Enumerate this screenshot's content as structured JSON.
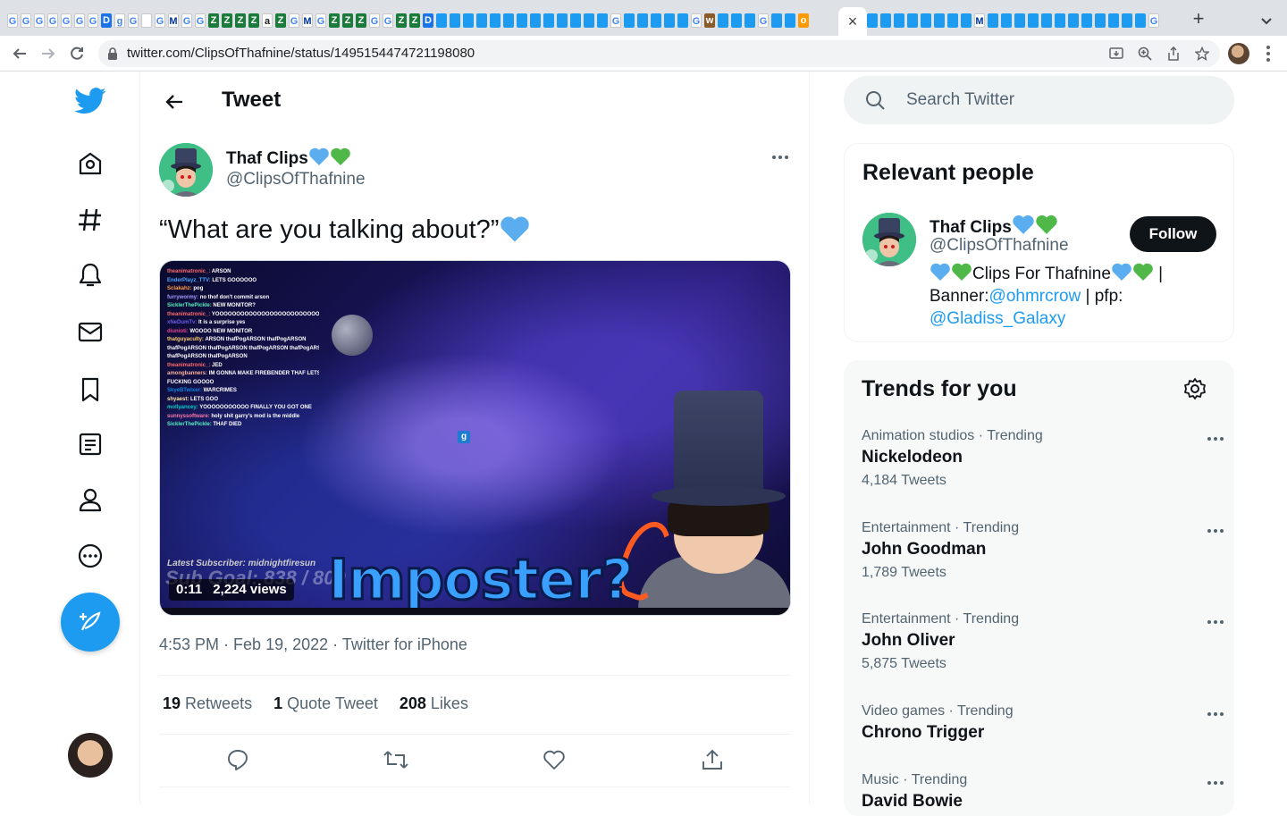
{
  "browser": {
    "url": "twitter.com/ClipsOfThafnine/status/1495154474721198080",
    "tab_close": "×",
    "new_tab": "+",
    "tab_icons_left": [
      "G",
      "G",
      "G",
      "G",
      "G",
      "G",
      "G",
      "D",
      "g",
      "G",
      "",
      "G",
      "M",
      "G",
      "G",
      "Z",
      "Z",
      "Z",
      "Z",
      "a",
      "Z",
      "G",
      "M",
      "G",
      "Z",
      "Z",
      "Z",
      "G",
      "G",
      "Z",
      "Z",
      "D",
      "t",
      "t",
      "t",
      "t",
      "t",
      "t",
      "t",
      "t",
      "t",
      "t",
      "t",
      "t",
      "t",
      "G",
      "t",
      "t",
      "t",
      "t",
      "t",
      "G",
      "w",
      "t",
      "t",
      "t",
      "G",
      "t",
      "t",
      "o"
    ],
    "tab_icons_right": [
      "t",
      "t",
      "t",
      "t",
      "t",
      "t",
      "t",
      "t",
      "M",
      "t",
      "t",
      "t",
      "t",
      "t",
      "t",
      "t",
      "t",
      "t",
      "t",
      "t",
      "t",
      "G"
    ]
  },
  "nav": {
    "items": [
      "home",
      "explore",
      "notifications",
      "messages",
      "bookmarks",
      "lists",
      "profile",
      "more"
    ]
  },
  "header": {
    "title": "Tweet"
  },
  "tweet": {
    "author_name": "Thaf Clips",
    "author_handle": "@ClipsOfThafnine",
    "text": "“What are you talking about?”",
    "media": {
      "overlay_text": "Imposter?",
      "latest_subscriber": "Latest Subscriber: midnightfiresun",
      "sub_goal": "Sub Goal: 838 / 800",
      "duration": "0:11",
      "views": "2,224 views",
      "chat": [
        {
          "user": "theanimatronic_",
          "msg": "ARSON",
          "color": "#ff6b6b"
        },
        {
          "user": "EnderPlayz_TTV",
          "msg": "LETS GOOOOOO",
          "color": "#4aa8ff"
        },
        {
          "user": "Sclakahz",
          "msg": "pog",
          "color": "#ff9f43"
        },
        {
          "user": "furrywormy",
          "msg": "no thof don't commit arson",
          "color": "#a29bfe"
        },
        {
          "user": "SicklerThePickle",
          "msg": "NEW MONITOR?",
          "color": "#55efc4"
        },
        {
          "user": "theanimatronic_",
          "msg": "YOOOOOOOOOOOOOOOOOOOOOOOOOOO",
          "color": "#ff6b6b"
        },
        {
          "user": "xNeDumTv",
          "msg": "It is a surprise yes",
          "color": "#6c5ce7"
        },
        {
          "user": "diunioti",
          "msg": "WOOOO NEW MONITOR",
          "color": "#e84393"
        },
        {
          "user": "thatguyaculty",
          "msg": "ARSON thafPogARSON thafPogARSON",
          "color": "#fdcb6e"
        },
        {
          "user": "",
          "msg": "thafPogARSON thafPogARSON thafPogARSON thafPogARSON",
          "color": "#fff"
        },
        {
          "user": "",
          "msg": "thafPogARSON thafPogARSON",
          "color": "#fff"
        },
        {
          "user": "theanimatronic_",
          "msg": "JED",
          "color": "#ff6b6b"
        },
        {
          "user": "amongbanners",
          "msg": "IM GONNA MAKE FIREBENDER THAF LETS",
          "color": "#fab1a0"
        },
        {
          "user": "",
          "msg": "FUCKING GOOOO",
          "color": "#fff"
        },
        {
          "user": "SkyeBTwixer",
          "msg": "WARCRIMES",
          "color": "#0984e3"
        },
        {
          "user": "shyaest",
          "msg": "LETS GOO",
          "color": "#ffeaa7"
        },
        {
          "user": "mollyancey",
          "msg": "YOOOOOOOOOOO FINALLY YOU GOT ONE",
          "color": "#00cec9"
        },
        {
          "user": "sunnyssoftware",
          "msg": "holy shit garry's mod is the middle",
          "color": "#fd79a8"
        },
        {
          "user": "SicklerThePickle",
          "msg": "THAF DIED",
          "color": "#55efc4"
        }
      ]
    },
    "time": "4:53 PM",
    "date": "Feb 19, 2022",
    "source": "Twitter for iPhone",
    "retweets": "19",
    "retweets_label": "Retweets",
    "quotes": "1",
    "quotes_label": "Quote Tweet",
    "likes": "208",
    "likes_label": "Likes"
  },
  "search": {
    "placeholder": "Search Twitter"
  },
  "relevant_people": {
    "title": "Relevant people",
    "name": "Thaf Clips",
    "handle": "@ClipsOfThafnine",
    "follow_label": "Follow",
    "bio_text1": "Clips For Thafnine",
    "bio_sep": " |",
    "bio_banner_label": "Banner:",
    "bio_banner_link": "@ohmrcrow",
    "bio_pfp_label": " | pfp:",
    "bio_pfp_link": "@Gladiss_Galaxy"
  },
  "trends": {
    "title": "Trends for you",
    "items": [
      {
        "category": "Animation studios · Trending",
        "name": "Nickelodeon",
        "count": "4,184 Tweets"
      },
      {
        "category": "Entertainment · Trending",
        "name": "John Goodman",
        "count": "1,789 Tweets"
      },
      {
        "category": "Entertainment · Trending",
        "name": "John Oliver",
        "count": "5,875 Tweets"
      },
      {
        "category": "Video games · Trending",
        "name": "Chrono Trigger",
        "count": ""
      },
      {
        "category": "Music · Trending",
        "name": "David Bowie",
        "count": ""
      }
    ]
  },
  "colors": {
    "twitter_blue": "#1d9bf0",
    "heart_blue": "#5aaef0",
    "heart_green": "#4fb848"
  }
}
